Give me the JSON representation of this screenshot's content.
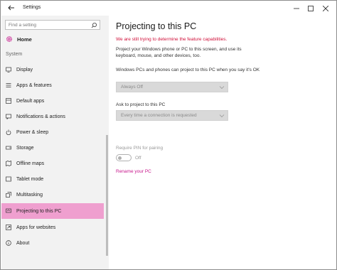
{
  "window": {
    "title": "Settings",
    "controls": [
      "minimize-icon",
      "maximize-icon",
      "close-icon"
    ]
  },
  "sidebar": {
    "search_placeholder": "Find a setting",
    "home_label": "Home",
    "section_label": "System",
    "active_color": "#ef9fcf",
    "items": [
      {
        "label": "Display",
        "icon": "monitor-icon"
      },
      {
        "label": "Apps & features",
        "icon": "apps-list-icon"
      },
      {
        "label": "Default apps",
        "icon": "default-apps-icon"
      },
      {
        "label": "Notifications & actions",
        "icon": "notifications-icon"
      },
      {
        "label": "Power & sleep",
        "icon": "power-icon"
      },
      {
        "label": "Storage",
        "icon": "storage-icon"
      },
      {
        "label": "Offline maps",
        "icon": "map-icon"
      },
      {
        "label": "Tablet mode",
        "icon": "tablet-icon"
      },
      {
        "label": "Multitasking",
        "icon": "multitasking-icon"
      },
      {
        "label": "Projecting to this PC",
        "icon": "projecting-icon",
        "active": true
      },
      {
        "label": "Apps for websites",
        "icon": "web-apps-icon"
      },
      {
        "label": "About",
        "icon": "info-icon"
      }
    ]
  },
  "main": {
    "title": "Projecting to this PC",
    "warning": "We are still trying to determine the feature capabilities.",
    "description": "Project your Windows phone or PC to this screen, and use its keyboard, mouse, and other devices, too.",
    "project_label": "Windows PCs and phones can project to this PC when you say it's OK",
    "project_value": "Always Off",
    "ask_label": "Ask to project to this PC",
    "ask_value": "Every time a connection is requested",
    "pin_label": "Require PIN for pairing",
    "pin_state": "Off",
    "rename_link": "Rename your PC",
    "warning_color": "#d0103a",
    "link_color": "#c7168c"
  }
}
